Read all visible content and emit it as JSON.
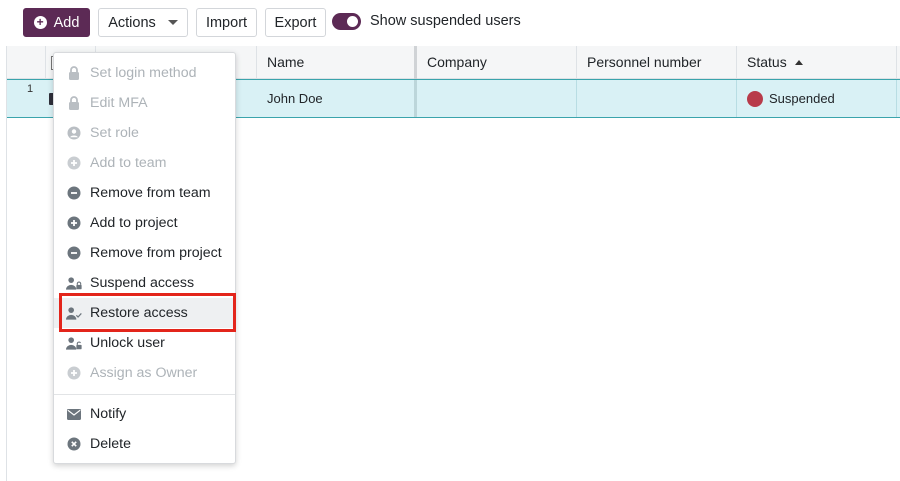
{
  "toolbar": {
    "add_label": "Add",
    "actions_label": "Actions",
    "import_label": "Import",
    "export_label": "Export",
    "toggle_label": "Show suspended users",
    "toggle_on": true,
    "accent_color": "#5c2a55"
  },
  "grid": {
    "columns": [
      "Name",
      "Company",
      "Personnel number",
      "Status"
    ],
    "sorted_column": "Status",
    "sort_direction": "ascending",
    "rows": [
      {
        "index": "1",
        "name": "John Doe",
        "company": "",
        "personnel_number": "",
        "status": "Suspended",
        "status_color": "#b83b4a"
      }
    ]
  },
  "menu": {
    "items": [
      {
        "label": "Set login method",
        "icon": "lock-icon",
        "enabled": false
      },
      {
        "label": "Edit MFA",
        "icon": "lock-icon",
        "enabled": false
      },
      {
        "label": "Set role",
        "icon": "user-circle-icon",
        "enabled": false
      },
      {
        "label": "Add to team",
        "icon": "plus-circle-icon",
        "enabled": false
      },
      {
        "label": "Remove from team",
        "icon": "minus-circle-icon",
        "enabled": true
      },
      {
        "label": "Add to project",
        "icon": "plus-circle-icon",
        "enabled": true
      },
      {
        "label": "Remove from project",
        "icon": "minus-circle-icon",
        "enabled": true
      },
      {
        "label": "Suspend access",
        "icon": "user-lock-icon",
        "enabled": true
      },
      {
        "label": "Restore access",
        "icon": "user-check-icon",
        "enabled": true,
        "highlighted": true
      },
      {
        "label": "Unlock user",
        "icon": "user-unlock-icon",
        "enabled": true
      },
      {
        "label": "Assign as Owner",
        "icon": "plus-circle-icon",
        "enabled": false
      },
      {
        "label": "Notify",
        "icon": "envelope-icon",
        "enabled": true
      },
      {
        "label": "Delete",
        "icon": "times-circle-icon",
        "enabled": true
      }
    ],
    "highlight_color": "#e3251b"
  }
}
